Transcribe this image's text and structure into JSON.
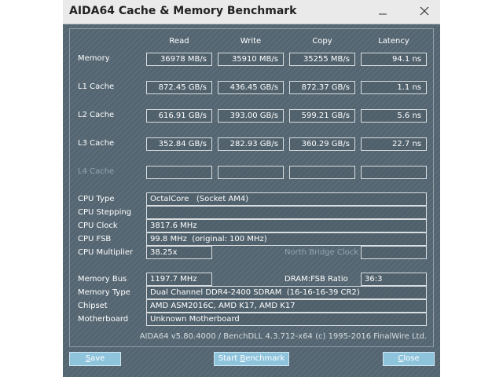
{
  "window": {
    "title": "AIDA64 Cache & Memory Benchmark",
    "minimize_icon": "minimize-icon",
    "close_icon": "close-icon"
  },
  "benchmark": {
    "columns": [
      "Read",
      "Write",
      "Copy",
      "Latency"
    ],
    "rows": [
      {
        "label": "Memory",
        "read": "36978 MB/s",
        "write": "35910 MB/s",
        "copy": "35255 MB/s",
        "latency": "94.1 ns"
      },
      {
        "label": "L1 Cache",
        "read": "872.45 GB/s",
        "write": "436.45 GB/s",
        "copy": "872.37 GB/s",
        "latency": "1.1 ns"
      },
      {
        "label": "L2 Cache",
        "read": "616.91 GB/s",
        "write": "393.00 GB/s",
        "copy": "599.21 GB/s",
        "latency": "5.6 ns"
      },
      {
        "label": "L3 Cache",
        "read": "352.84 GB/s",
        "write": "282.93 GB/s",
        "copy": "360.29 GB/s",
        "latency": "22.7 ns"
      },
      {
        "label": "L4 Cache",
        "read": "",
        "write": "",
        "copy": "",
        "latency": ""
      }
    ]
  },
  "cpu": {
    "type_label": "CPU Type",
    "type_value": "OctalCore   (Socket AM4)",
    "stepping_label": "CPU Stepping",
    "stepping_value": "",
    "clock_label": "CPU Clock",
    "clock_value": "3817.6 MHz",
    "fsb_label": "CPU FSB",
    "fsb_value": "99.8 MHz  (original: 100 MHz)",
    "multiplier_label": "CPU Multiplier",
    "multiplier_value": "38.25x",
    "nb_clock_label": "North Bridge Clock",
    "nb_clock_value": ""
  },
  "memory": {
    "bus_label": "Memory Bus",
    "bus_value": "1197.7 MHz",
    "ratio_label": "DRAM:FSB Ratio",
    "ratio_value": "36:3",
    "type_label": "Memory Type",
    "type_value": "Dual Channel DDR4-2400 SDRAM  (16-16-16-39 CR2)",
    "chipset_label": "Chipset",
    "chipset_value": "AMD ASM2016C, AMD K17, AMD K17",
    "motherboard_label": "Motherboard",
    "motherboard_value": "Unknown Motherboard"
  },
  "footer": {
    "version": "AIDA64 v5.80.4000 / BenchDLL 4.3.712-x64  (c) 1995-2016 FinalWire Ltd."
  },
  "buttons": {
    "save": {
      "key": "S",
      "rest": "ave"
    },
    "start": {
      "pre": "Start ",
      "key": "B",
      "rest": "enchmark"
    },
    "close": {
      "key": "C",
      "rest": "lose"
    }
  }
}
